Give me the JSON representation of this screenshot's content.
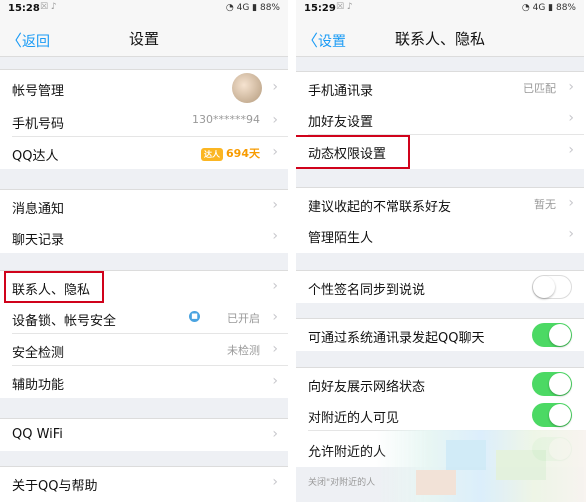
{
  "left": {
    "status": {
      "time": "15:28",
      "signal": "4G",
      "battery": "88%"
    },
    "nav": {
      "back": "返回",
      "title": "设置"
    },
    "rows": {
      "account": "帐号管理",
      "phone_label": "手机号码",
      "phone_value": "130******94",
      "qq_label": "QQ达人",
      "qq_badge": "达人",
      "qq_value": "694天",
      "msg": "消息通知",
      "chat": "聊天记录",
      "contacts": "联系人、隐私",
      "lock_label": "设备锁、帐号安全",
      "lock_value": "已开启",
      "security_label": "安全检测",
      "security_value": "未检测",
      "assist": "辅助功能",
      "wifi": "QQ WiFi",
      "about": "关于QQ与帮助"
    }
  },
  "right": {
    "status": {
      "time": "15:29",
      "signal": "4G",
      "battery": "88%"
    },
    "nav": {
      "back": "设置",
      "title": "联系人、隐私"
    },
    "rows": {
      "contacts_label": "手机通讯录",
      "contacts_value": "已匹配",
      "add_friend": "加好友设置",
      "dynamic": "动态权限设置",
      "collapse_label": "建议收起的不常联系好友",
      "collapse_value": "暂无",
      "strangers": "管理陌生人",
      "signature_sync": "个性签名同步到说说",
      "qq_chat_via_contacts": "可通过系统通讯录发起QQ聊天",
      "network_status": "向好友展示网络状态",
      "visible_nearby": "对附近的人可见",
      "allow_nearby": "允许附近的人"
    },
    "toggles": {
      "signature_sync": false,
      "qq_chat_via_contacts": true,
      "network_status": true,
      "visible_nearby": true,
      "allow_nearby": true
    },
    "note": "关闭\"对附近的人"
  }
}
